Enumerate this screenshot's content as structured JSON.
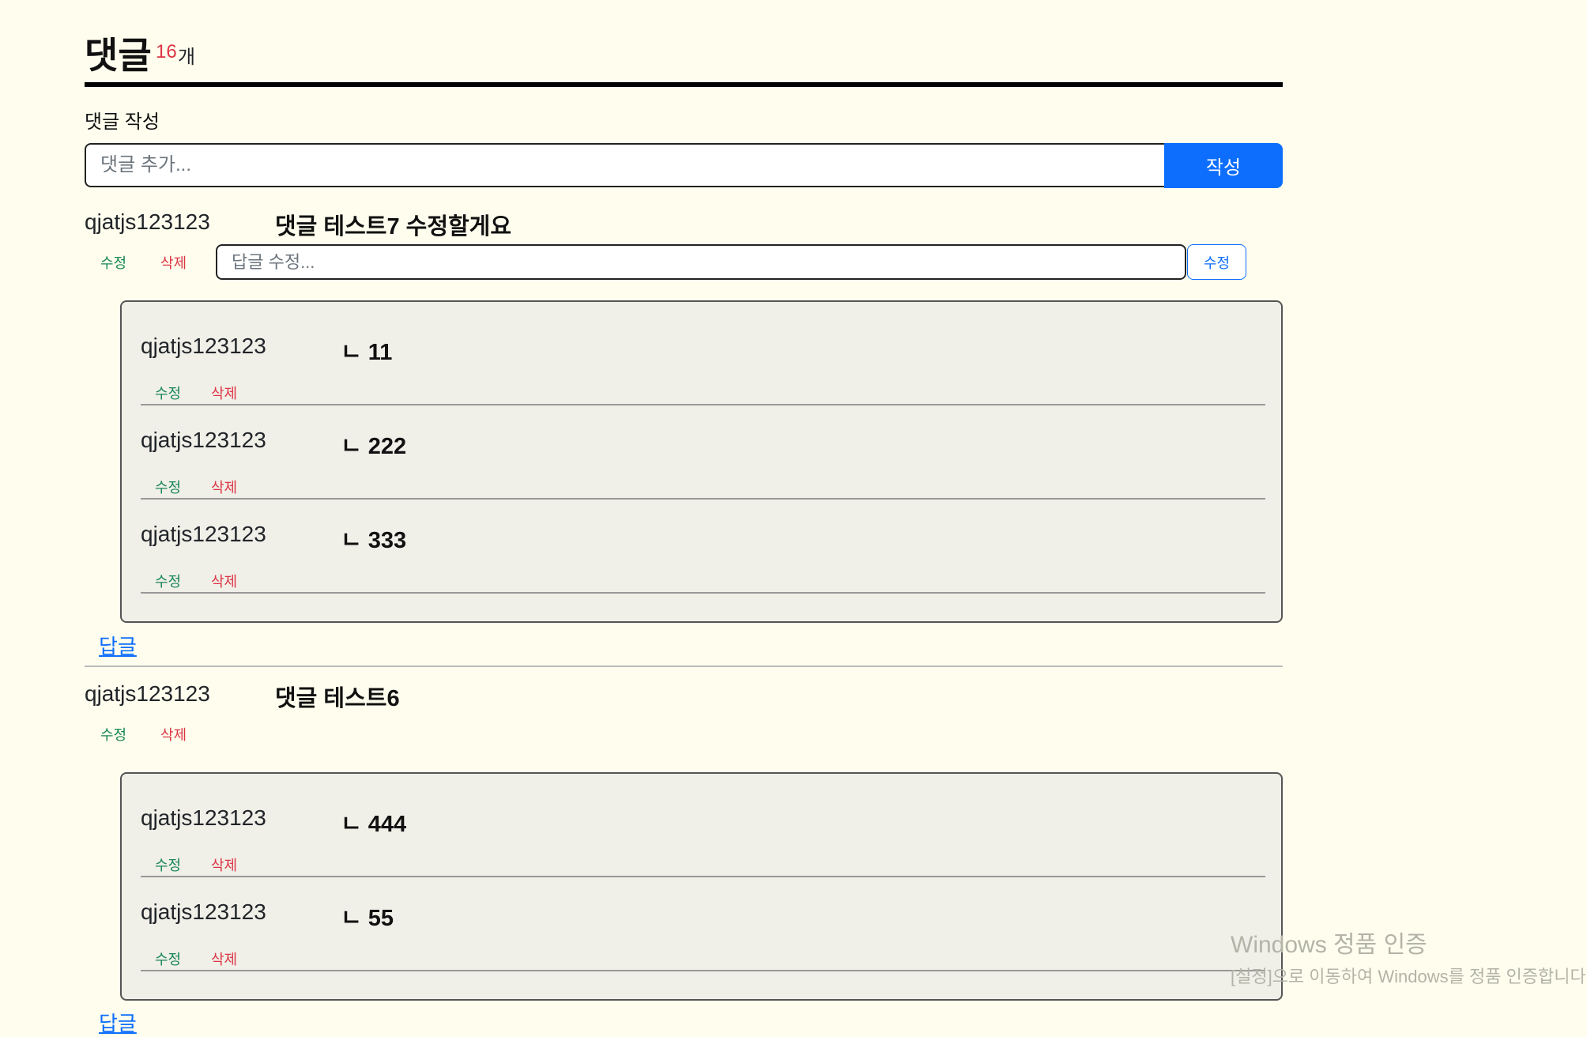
{
  "header": {
    "title": "댓글",
    "count": "16",
    "count_unit": "개"
  },
  "write": {
    "label": "댓글 작성",
    "placeholder": "댓글 추가...",
    "button": "작성"
  },
  "comments": [
    {
      "author": "qjatjs123123",
      "text": "댓글 테스트7 수정할게요",
      "edit": "수정",
      "delete": "삭제",
      "reply_edit": {
        "placeholder": "답글 수정...",
        "button": "수정"
      },
      "replies": [
        {
          "author": "qjatjs123123",
          "text": "ㄴ 11",
          "edit": "수정",
          "delete": "삭제"
        },
        {
          "author": "qjatjs123123",
          "text": "ㄴ 222",
          "edit": "수정",
          "delete": "삭제"
        },
        {
          "author": "qjatjs123123",
          "text": "ㄴ 333",
          "edit": "수정",
          "delete": "삭제"
        }
      ],
      "reply_link": "답글"
    },
    {
      "author": "qjatjs123123",
      "text": "댓글 테스트6",
      "edit": "수정",
      "delete": "삭제",
      "replies": [
        {
          "author": "qjatjs123123",
          "text": "ㄴ 444",
          "edit": "수정",
          "delete": "삭제"
        },
        {
          "author": "qjatjs123123",
          "text": "ㄴ 55",
          "edit": "수정",
          "delete": "삭제"
        }
      ],
      "reply_link": "답글"
    }
  ],
  "watermark": {
    "line1": "Windows 정품 인증",
    "line2": "[설정]으로 이동하여 Windows를 정품 인증합니다."
  }
}
